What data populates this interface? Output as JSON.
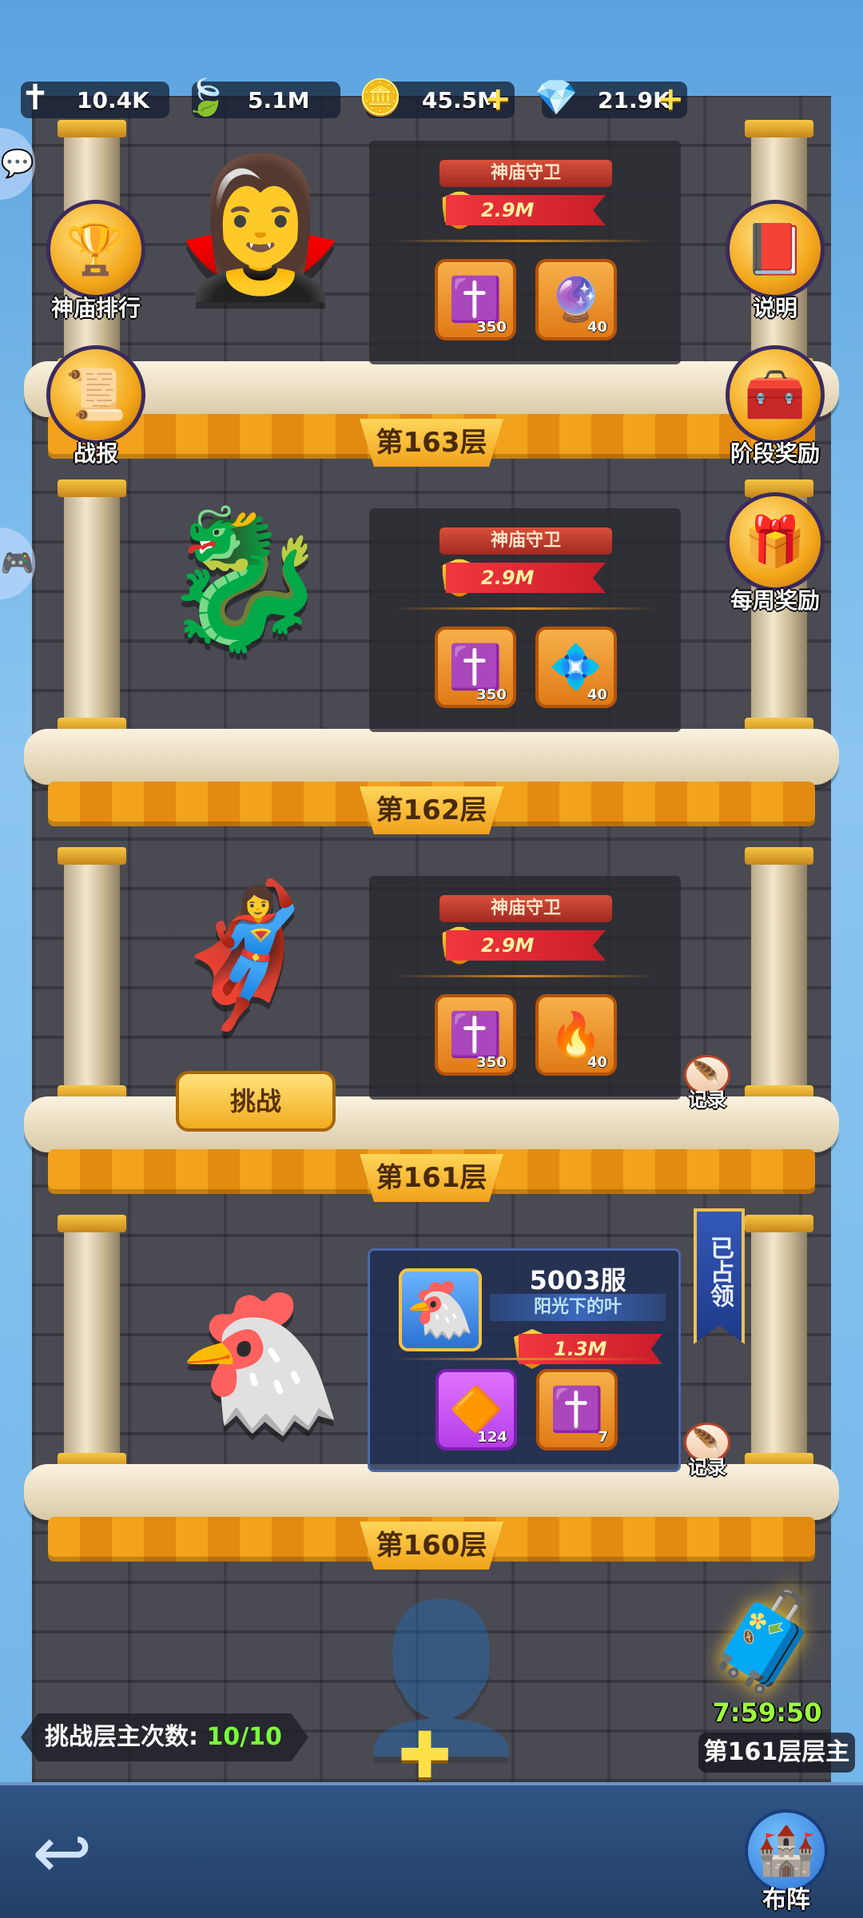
{
  "resources": [
    {
      "icon": "gold-cross-icon",
      "value": "10.4K",
      "plus": false
    },
    {
      "icon": "green-leaf-icon",
      "value": "5.1M",
      "plus": false
    },
    {
      "icon": "gold-coin-icon",
      "value": "45.5M",
      "plus": true
    },
    {
      "icon": "green-gem-icon",
      "value": "21.9K",
      "plus": true
    }
  ],
  "left_buttons": {
    "ranking": "神庙排行",
    "report": "战报"
  },
  "right_buttons": {
    "help": "说明",
    "stage_reward": "阶段奖励",
    "weekly_reward": "每周奖励"
  },
  "floors": [
    {
      "label": "第163层",
      "guard_title": "神庙守卫",
      "power": "2.9M",
      "rewards": [
        {
          "icon": "gold-cross-icon",
          "count": "350"
        },
        {
          "icon": "purple-crystal-icon",
          "count": "40"
        }
      ]
    },
    {
      "label": "第162层",
      "guard_title": "神庙守卫",
      "power": "2.9M",
      "rewards": [
        {
          "icon": "gold-cross-icon",
          "count": "350"
        },
        {
          "icon": "blue-crystal-icon",
          "count": "40"
        }
      ]
    },
    {
      "label": "第161层",
      "guard_title": "神庙守卫",
      "power": "2.9M",
      "rewards": [
        {
          "icon": "gold-cross-icon",
          "count": "350"
        },
        {
          "icon": "red-crystal-icon",
          "count": "40"
        }
      ],
      "challenge_label": "挑战",
      "record_label": "记录"
    },
    {
      "label": "第160层",
      "server": "5003服",
      "player_name": "阳光下的叶",
      "power": "1.3M",
      "rewards": [
        {
          "icon": "purple-rune-icon",
          "count": "124"
        },
        {
          "icon": "gold-cross-icon",
          "count": "7"
        }
      ],
      "occupied_label": "已占领",
      "record_label": "记录"
    }
  ],
  "attempts": {
    "label": "挑战层主次数:",
    "value": "10/10"
  },
  "floor_lord": {
    "timer": "7:59:50",
    "label": "第161层层主"
  },
  "bottom": {
    "formation_label": "布阵"
  }
}
